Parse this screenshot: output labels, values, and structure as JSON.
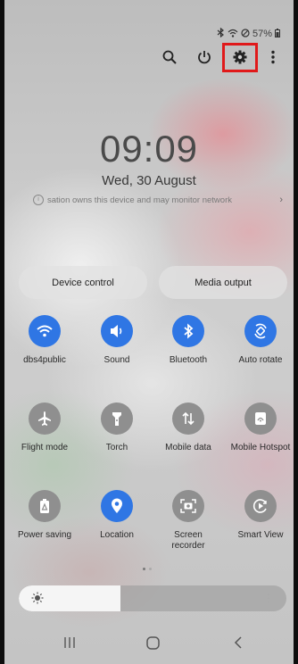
{
  "status_bar": {
    "battery": "57%",
    "icons": [
      "bluetooth-icon",
      "wifi-icon",
      "do-not-disturb-icon",
      "battery-icon"
    ]
  },
  "top_icons": [
    "search-icon",
    "power-icon",
    "settings-gear-icon",
    "more-options-icon"
  ],
  "clock": {
    "time": "09:09",
    "date": "Wed, 30 August"
  },
  "notice": {
    "text": "sation owns this device and may monitor network"
  },
  "pills": {
    "device_control": "Device control",
    "media_output": "Media output"
  },
  "tiles": [
    {
      "label": "dbs4public",
      "icon": "wifi-icon",
      "active": true
    },
    {
      "label": "Sound",
      "icon": "sound-icon",
      "active": true
    },
    {
      "label": "Bluetooth",
      "icon": "bluetooth-icon",
      "active": true
    },
    {
      "label": "Auto rotate",
      "icon": "auto-rotate-icon",
      "active": true
    },
    {
      "label": "Flight mode",
      "icon": "airplane-icon",
      "active": false
    },
    {
      "label": "Torch",
      "icon": "torch-icon",
      "active": false
    },
    {
      "label": "Mobile data",
      "icon": "mobile-data-icon",
      "active": false
    },
    {
      "label": "Mobile Hotspot",
      "icon": "hotspot-icon",
      "active": false
    },
    {
      "label": "Power saving",
      "icon": "power-saving-icon",
      "active": false
    },
    {
      "label": "Location",
      "icon": "location-icon",
      "active": true
    },
    {
      "label": "Screen recorder",
      "icon": "screen-recorder-icon",
      "active": false
    },
    {
      "label": "Smart View",
      "icon": "smart-view-icon",
      "active": false
    }
  ],
  "brightness": {
    "level": 0.38
  },
  "colors": {
    "accent": "#2f76e4",
    "inactive": "#8f8f8f",
    "highlight": "#e0191a"
  }
}
